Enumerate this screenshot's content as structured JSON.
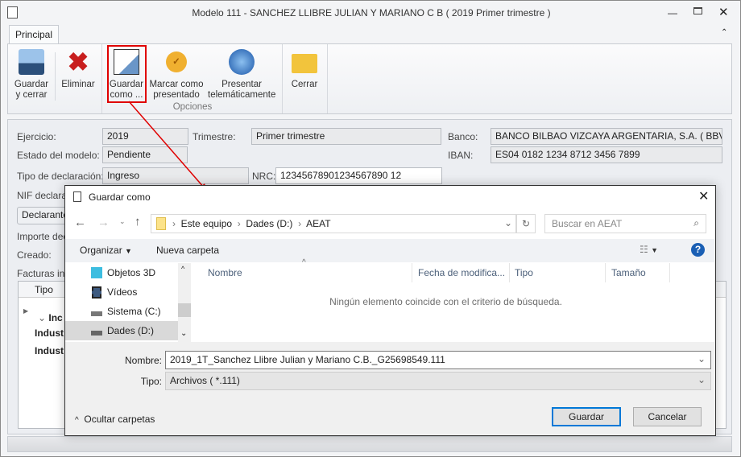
{
  "window": {
    "title": "Modelo 111 -  SANCHEZ LLIBRE JULIAN Y MARIANO C B ( 2019 Primer trimestre )"
  },
  "ribbon": {
    "tab": "Principal",
    "group_label": "Opciones",
    "buttons": [
      {
        "l1": "Guardar",
        "l2": "y cerrar"
      },
      {
        "l1": "Eliminar",
        "l2": ""
      },
      {
        "l1": "Guardar",
        "l2": "como ..."
      },
      {
        "l1": "Marcar como",
        "l2": "presentado"
      },
      {
        "l1": "Presentar",
        "l2": "telemáticamente"
      },
      {
        "l1": "Cerrar",
        "l2": ""
      }
    ]
  },
  "form": {
    "ejercicio_label": "Ejercicio:",
    "ejercicio": "2019",
    "trimestre_label": "Trimestre:",
    "trimestre": "Primer trimestre",
    "banco_label": "Banco:",
    "banco": "BANCO BILBAO VIZCAYA ARGENTARIA, S.A. ( BBVAESMM",
    "estado_label": "Estado del modelo:",
    "estado": "Pendiente",
    "iban_label": "IBAN:",
    "iban": "ES04 0182 1234 8712 3456 7899",
    "tipo_label": "Tipo de declaración:",
    "tipo": "Ingreso",
    "nrc_label": "NRC:",
    "nrc": "12345678901234567890 12",
    "nif_label": "NIF declaran",
    "declarante_label": "Declarante:",
    "importe_label": "Importe decl",
    "creado_label": "Creado:",
    "facturas_label": "Facturas incl",
    "table": {
      "col_tipo": "Tipo",
      "group_row": "Inc",
      "rows": [
        "Indust",
        "Indust"
      ]
    }
  },
  "dialog": {
    "title": "Guardar como",
    "breadcrumb": [
      "Este equipo",
      "Dades (D:)",
      "AEAT"
    ],
    "search_placeholder": "Buscar en AEAT",
    "organize": "Organizar",
    "new_folder": "Nueva carpeta",
    "nav_items": [
      "Objetos 3D",
      "Vídeos",
      "Sistema (C:)",
      "Dades (D:)"
    ],
    "columns": [
      "Nombre",
      "Fecha de modifica...",
      "Tipo",
      "Tamaño"
    ],
    "empty_message": "Ningún elemento coincide con el criterio de búsqueda.",
    "name_label": "Nombre:",
    "name_value": "2019_1T_Sanchez Llibre Julian y Mariano C.B._G25698549.111",
    "type_label": "Tipo:",
    "type_value": "Archivos  ( *.111)",
    "hide_folders": "Ocultar carpetas",
    "save": "Guardar",
    "cancel": "Cancelar"
  },
  "colors": {
    "highlight": "#e00000",
    "accent": "#0078d7"
  }
}
